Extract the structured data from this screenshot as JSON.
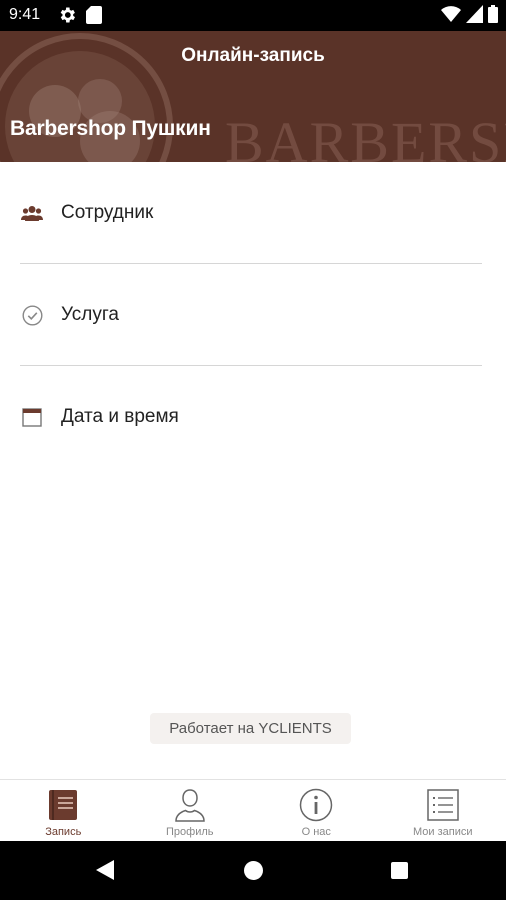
{
  "status_bar": {
    "time": "9:41"
  },
  "header": {
    "title": "Онлайн-запись",
    "brand": "Barbershop Пушкин",
    "watermark": "BARBERSH",
    "color": "#5a3328"
  },
  "list": {
    "items": [
      {
        "label": "Сотрудник",
        "icon": "people-icon"
      },
      {
        "label": "Услуга",
        "icon": "check-circle-icon"
      },
      {
        "label": "Дата и время",
        "icon": "calendar-icon"
      }
    ]
  },
  "powered_by": "Работает на YCLIENTS",
  "bottom_nav": {
    "items": [
      {
        "label": "Запись",
        "icon": "book-icon",
        "active": true
      },
      {
        "label": "Профиль",
        "icon": "person-icon",
        "active": false
      },
      {
        "label": "О нас",
        "icon": "info-icon",
        "active": false
      },
      {
        "label": "Мои записи",
        "icon": "list-icon",
        "active": false
      }
    ]
  },
  "colors": {
    "accent": "#6b3b2e",
    "header": "#5a3328"
  }
}
